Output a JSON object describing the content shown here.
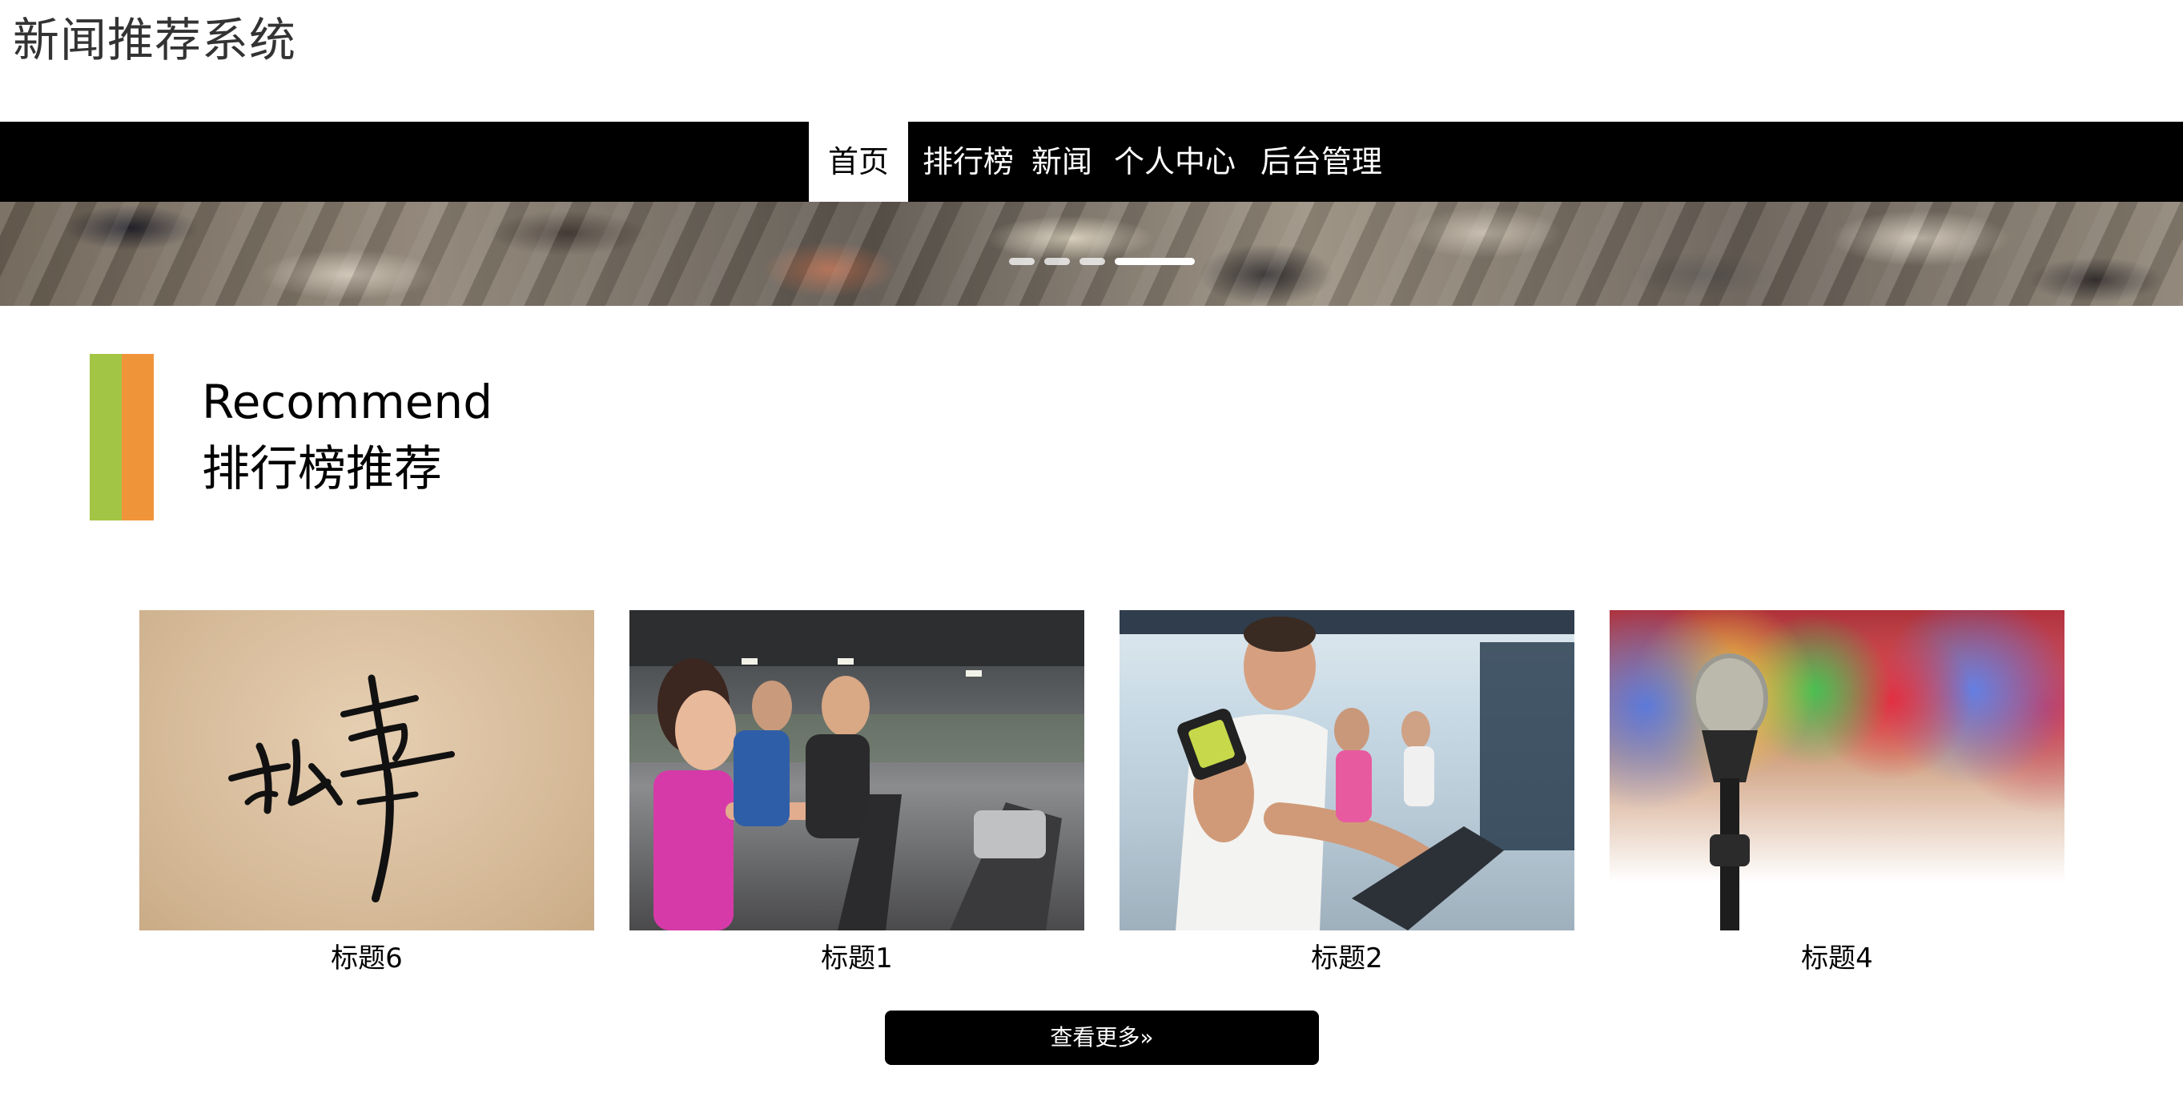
{
  "header": {
    "site_title": "新闻推荐系统"
  },
  "nav": {
    "items": [
      {
        "label": "首页",
        "active": true
      },
      {
        "label": "排行榜",
        "active": false
      },
      {
        "label": "新闻",
        "active": false
      },
      {
        "label": "个人中心",
        "active": false
      },
      {
        "label": "后台管理",
        "active": false
      }
    ]
  },
  "banner": {
    "slide_count": 4,
    "active_slide": 4
  },
  "section": {
    "title_en": "Recommend",
    "title_zh": "排行榜推荐",
    "accent_colors": [
      "#a3c545",
      "#f0943a"
    ]
  },
  "cards": [
    {
      "title": "标题6",
      "image": "calligraphy-image"
    },
    {
      "title": "标题1",
      "image": "gym-elliptical-image"
    },
    {
      "title": "标题2",
      "image": "gym-cycling-image"
    },
    {
      "title": "标题4",
      "image": "microphone-stage-image"
    }
  ],
  "more_button": {
    "label": "查看更多»"
  },
  "colors": {
    "nav_bg": "#000000",
    "button_bg": "#000000",
    "text": "#000000"
  }
}
